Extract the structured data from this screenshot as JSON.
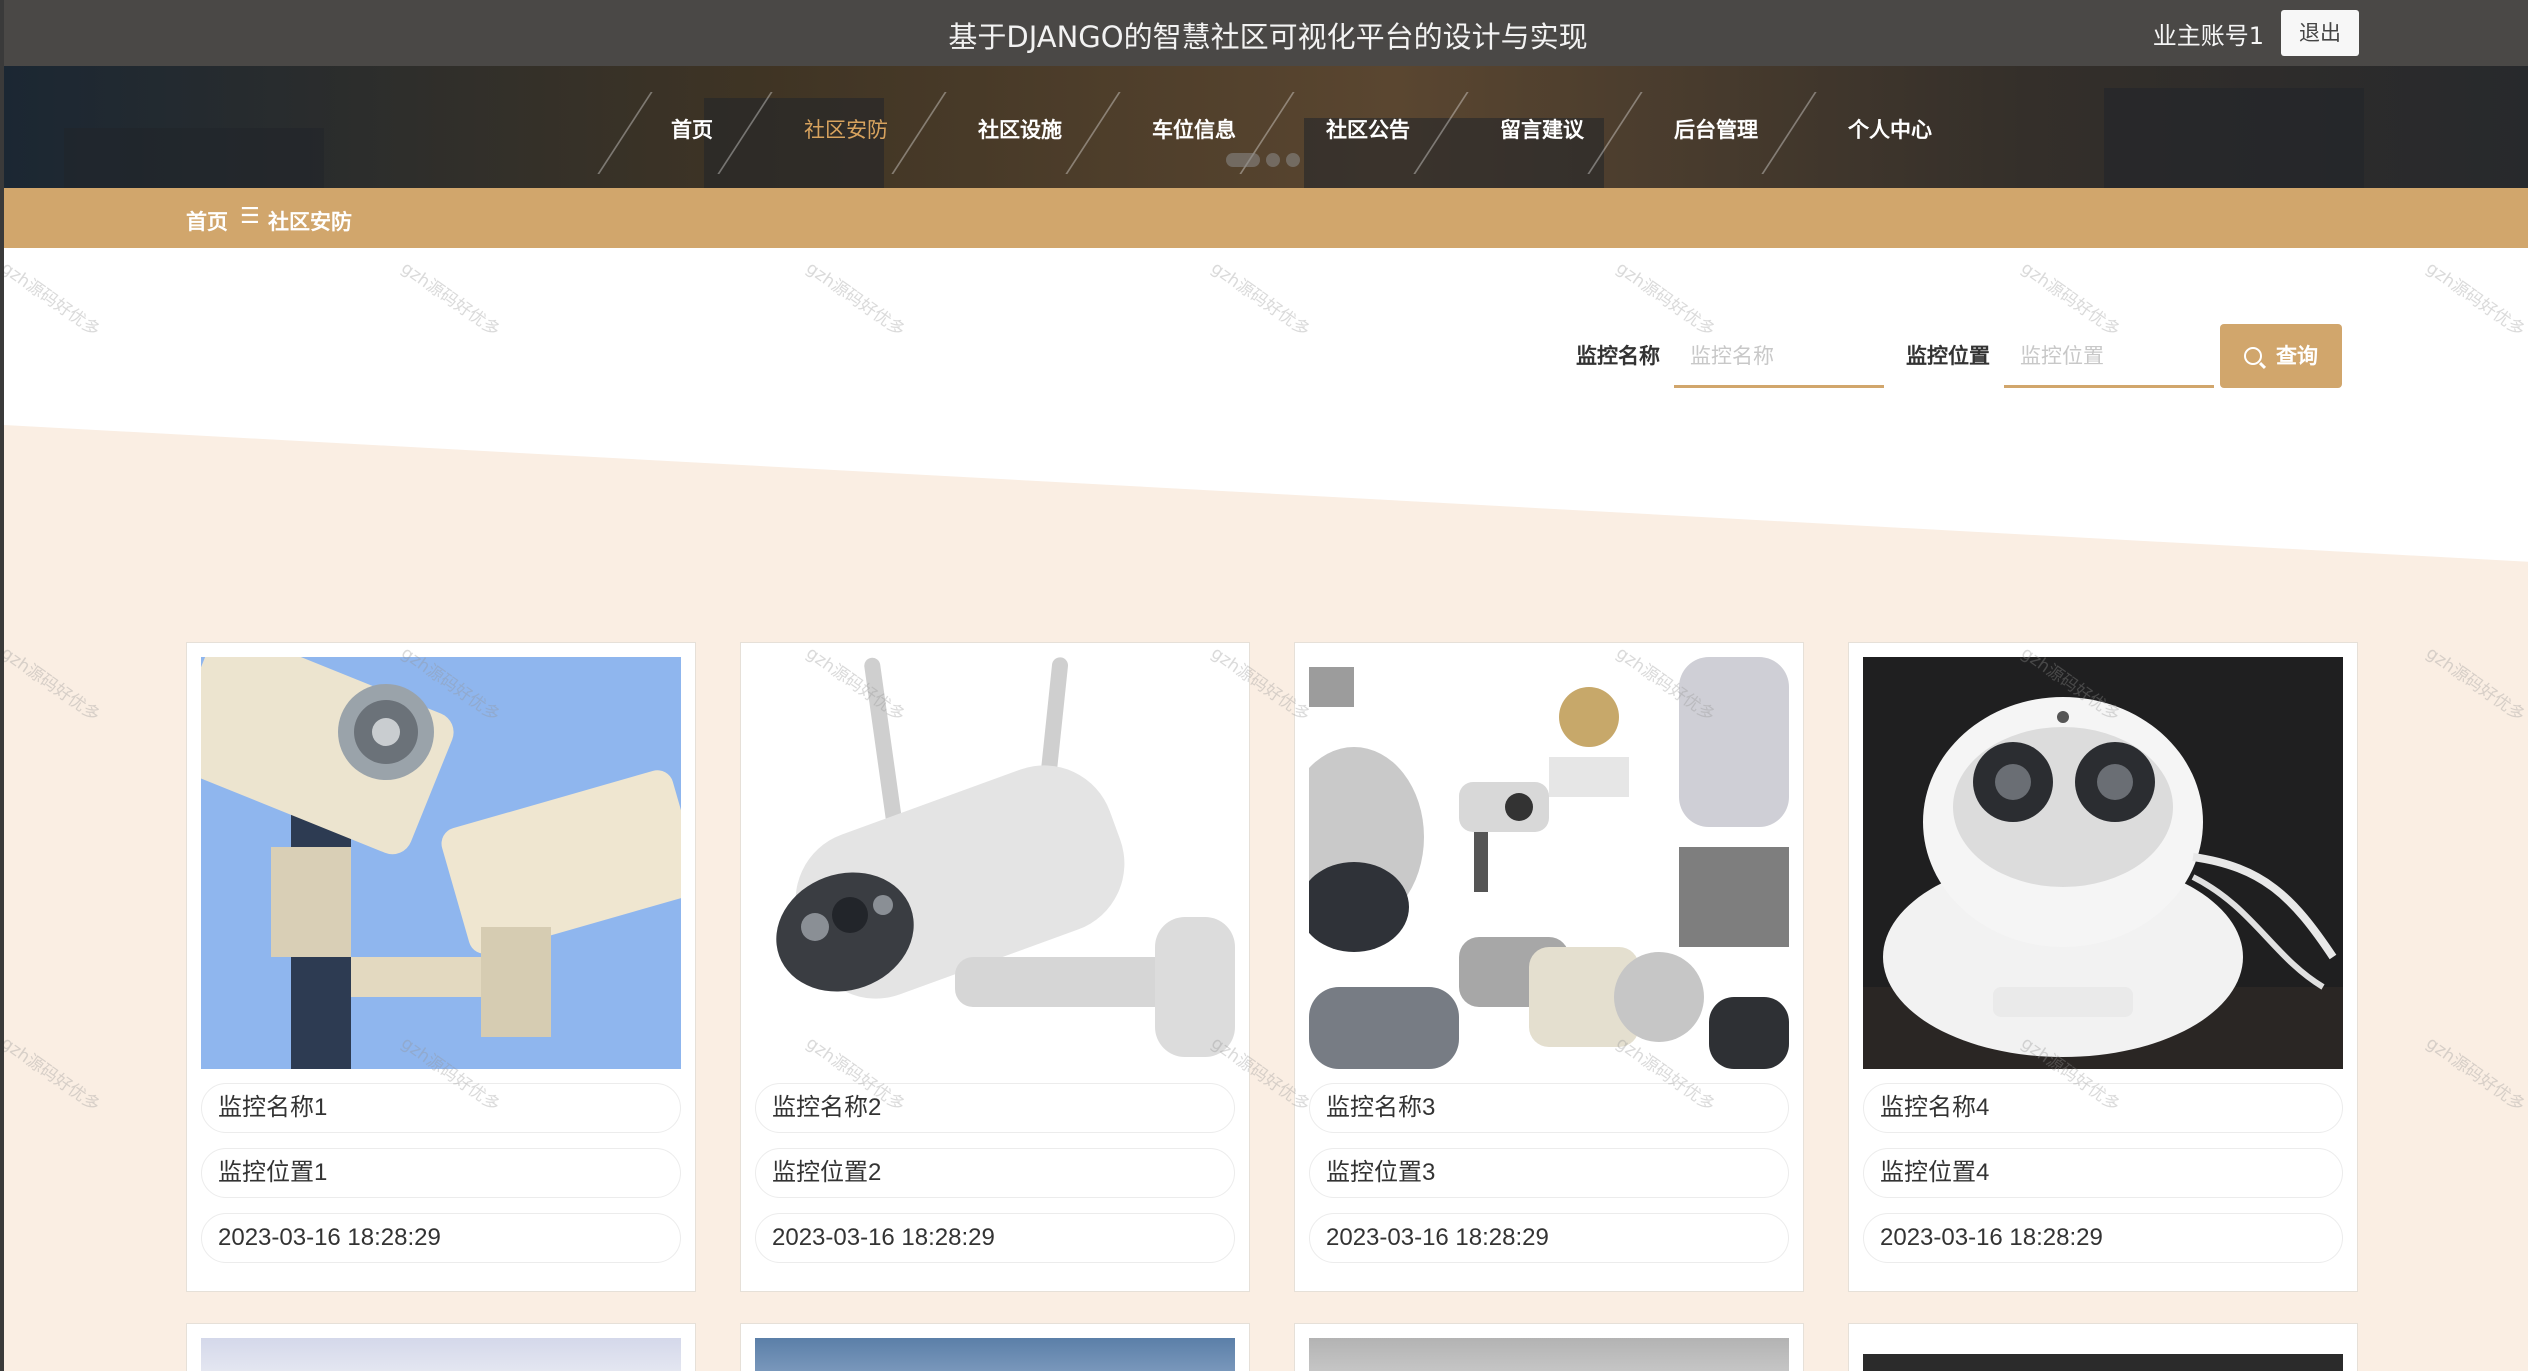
{
  "header": {
    "title": "基于DJANGO的智慧社区可视化平台的设计与实现",
    "account": "业主账号1",
    "logout_label": "退出"
  },
  "nav": {
    "items": [
      {
        "label": "首页"
      },
      {
        "label": "社区安防",
        "active": true
      },
      {
        "label": "社区设施"
      },
      {
        "label": "车位信息"
      },
      {
        "label": "社区公告"
      },
      {
        "label": "留言建议"
      },
      {
        "label": "后台管理"
      },
      {
        "label": "个人中心"
      }
    ]
  },
  "breadcrumb": {
    "home": "首页",
    "separator": "☰",
    "current": "社区安防"
  },
  "search": {
    "name_label": "监控名称",
    "name_placeholder": "监控名称",
    "location_label": "监控位置",
    "location_placeholder": "监控位置",
    "button_label": "查询",
    "button_icon": "search-icon"
  },
  "cards": [
    {
      "name": "监控名称1",
      "location": "监控位置1",
      "time": "2023-03-16 18:28:29"
    },
    {
      "name": "监控名称2",
      "location": "监控位置2",
      "time": "2023-03-16 18:28:29"
    },
    {
      "name": "监控名称3",
      "location": "监控位置3",
      "time": "2023-03-16 18:28:29"
    },
    {
      "name": "监控名称4",
      "location": "监控位置4",
      "time": "2023-03-16 18:28:29"
    }
  ],
  "watermark": "gzh源码好优多",
  "colors": {
    "accent": "#d1a66c",
    "topbar": "#4a4846",
    "section_bg": "#faeee3"
  }
}
